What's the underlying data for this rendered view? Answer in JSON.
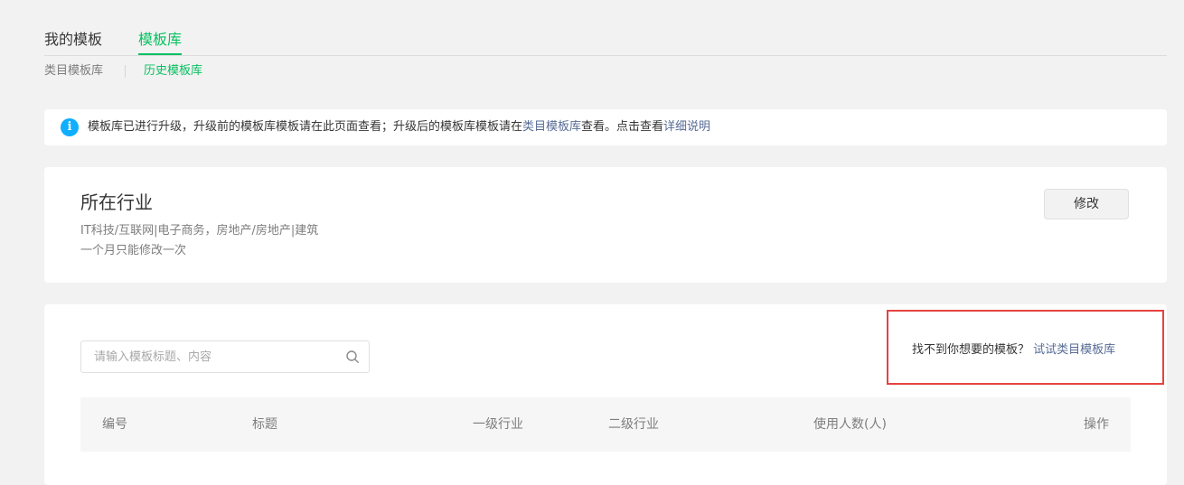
{
  "top_tabs": [
    "我的模板",
    "模板库"
  ],
  "sub_tabs": [
    "类目模板库",
    "历史模板库"
  ],
  "notice": {
    "icon": "info-icon",
    "text_before": "模板库已进行升级，升级前的模板库模板请在此页面查看；升级后的模板库模板请在",
    "link1": "类目模板库",
    "text_middle": "查看。点击查看",
    "link2": "详细说明"
  },
  "industry": {
    "title": "所在行业",
    "value": "IT科技/互联网|电子商务，房地产/房地产|建筑",
    "note": "一个月只能修改一次",
    "modify_label": "修改"
  },
  "search": {
    "placeholder": "请输入模板标题、内容"
  },
  "hint": {
    "text": "找不到你想要的模板？",
    "link": "试试类目模板库"
  },
  "table": {
    "headers": [
      "编号",
      "标题",
      "一级行业",
      "二级行业",
      "使用人数(人)",
      "操作"
    ]
  },
  "colors": {
    "accent": "#07c160",
    "link": "#576b95",
    "info": "#10aeff",
    "highlight_border": "#e64340"
  }
}
